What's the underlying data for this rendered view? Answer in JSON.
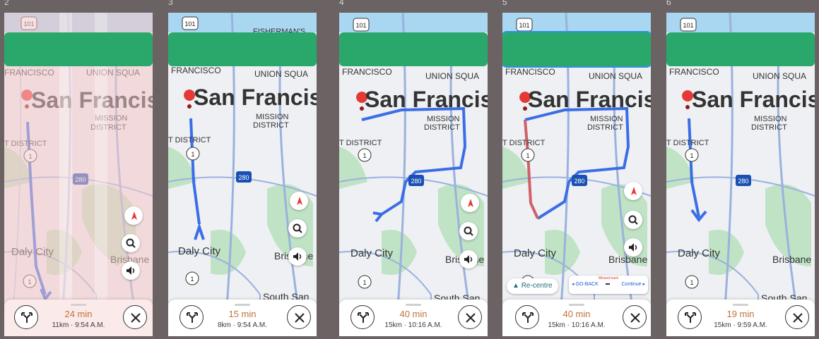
{
  "frames": [
    {
      "number": "2",
      "eta": "24 min",
      "distance": "11km",
      "arrival": "9:54 A.M."
    },
    {
      "number": "3",
      "eta": "15 min",
      "distance": "8km",
      "arrival": "9:54 A.M."
    },
    {
      "number": "4",
      "eta": "40 min",
      "distance": "15km",
      "arrival": "10:16 A.M."
    },
    {
      "number": "5",
      "eta": "40 min",
      "distance": "15km",
      "arrival": "10:16 A.M."
    },
    {
      "number": "6",
      "eta": "19 min",
      "distance": "15km",
      "arrival": "9:59 A.M."
    }
  ],
  "map_labels": {
    "city": "San Francis",
    "neighborhood_top": "FRANCISCO",
    "union_square": "UNION SQUA",
    "fisherman": "FISHERMAN'S",
    "mission_1": "MISSION",
    "mission_2": "DISTRICT",
    "district": "T DISTRICT",
    "daly_city": "Daly City",
    "brisbane": "Brisbane",
    "south_sf": "South San",
    "shield_101": "101",
    "shield_280": "280",
    "shield_1": "1",
    "shield_1b": "1"
  },
  "recentre": {
    "label": "Re-centre"
  },
  "missed_track": {
    "title": "Missed track",
    "go_back": "GO-BACK",
    "continue": "Continue"
  },
  "colors": {
    "banner": "#2aa86c",
    "route": "#3b6ee6",
    "missed_route": "#d0606a",
    "eta": "#c0733a",
    "background": "#6b6363"
  },
  "icons": [
    "route-options-icon",
    "close-icon",
    "compass-icon",
    "search-icon",
    "volume-icon",
    "pin-icon",
    "navigation-arrow-icon"
  ]
}
